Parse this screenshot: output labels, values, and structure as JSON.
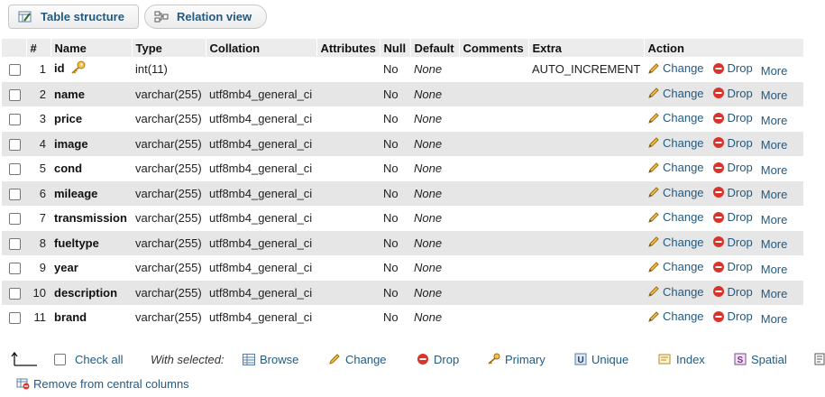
{
  "tabs": [
    {
      "label": "Table structure",
      "icon": "table-structure-icon"
    },
    {
      "label": "Relation view",
      "icon": "relation-view-icon"
    }
  ],
  "columns": [
    "#",
    "Name",
    "Type",
    "Collation",
    "Attributes",
    "Null",
    "Default",
    "Comments",
    "Extra",
    "Action"
  ],
  "rows": [
    {
      "num": "1",
      "name": "id",
      "type": "int(11)",
      "collation": "",
      "attributes": "",
      "null": "No",
      "default": "None",
      "comments": "",
      "extra": "AUTO_INCREMENT",
      "primary": true
    },
    {
      "num": "2",
      "name": "name",
      "type": "varchar(255)",
      "collation": "utf8mb4_general_ci",
      "attributes": "",
      "null": "No",
      "default": "None",
      "comments": "",
      "extra": ""
    },
    {
      "num": "3",
      "name": "price",
      "type": "varchar(255)",
      "collation": "utf8mb4_general_ci",
      "attributes": "",
      "null": "No",
      "default": "None",
      "comments": "",
      "extra": ""
    },
    {
      "num": "4",
      "name": "image",
      "type": "varchar(255)",
      "collation": "utf8mb4_general_ci",
      "attributes": "",
      "null": "No",
      "default": "None",
      "comments": "",
      "extra": ""
    },
    {
      "num": "5",
      "name": "cond",
      "type": "varchar(255)",
      "collation": "utf8mb4_general_ci",
      "attributes": "",
      "null": "No",
      "default": "None",
      "comments": "",
      "extra": ""
    },
    {
      "num": "6",
      "name": "mileage",
      "type": "varchar(255)",
      "collation": "utf8mb4_general_ci",
      "attributes": "",
      "null": "No",
      "default": "None",
      "comments": "",
      "extra": ""
    },
    {
      "num": "7",
      "name": "transmission",
      "type": "varchar(255)",
      "collation": "utf8mb4_general_ci",
      "attributes": "",
      "null": "No",
      "default": "None",
      "comments": "",
      "extra": ""
    },
    {
      "num": "8",
      "name": "fueltype",
      "type": "varchar(255)",
      "collation": "utf8mb4_general_ci",
      "attributes": "",
      "null": "No",
      "default": "None",
      "comments": "",
      "extra": ""
    },
    {
      "num": "9",
      "name": "year",
      "type": "varchar(255)",
      "collation": "utf8mb4_general_ci",
      "attributes": "",
      "null": "No",
      "default": "None",
      "comments": "",
      "extra": ""
    },
    {
      "num": "10",
      "name": "description",
      "type": "varchar(255)",
      "collation": "utf8mb4_general_ci",
      "attributes": "",
      "null": "No",
      "default": "None",
      "comments": "",
      "extra": ""
    },
    {
      "num": "11",
      "name": "brand",
      "type": "varchar(255)",
      "collation": "utf8mb4_general_ci",
      "attributes": "",
      "null": "No",
      "default": "None",
      "comments": "",
      "extra": ""
    }
  ],
  "row_actions": {
    "change": "Change",
    "drop": "Drop",
    "more": "More"
  },
  "footer": {
    "check_all": "Check all",
    "with_selected": "With selected:",
    "browse": "Browse",
    "change": "Change",
    "drop": "Drop",
    "primary": "Primary",
    "unique": "Unique",
    "index": "Index",
    "spatial": "Spatial",
    "remove_central": "Remove from central columns"
  },
  "colors": {
    "link": "#235a81",
    "header_bg": "#ececec",
    "stripe_bg": "#e6e6e6",
    "drop_red": "#d9342b",
    "pencil": "#e0a33a"
  }
}
